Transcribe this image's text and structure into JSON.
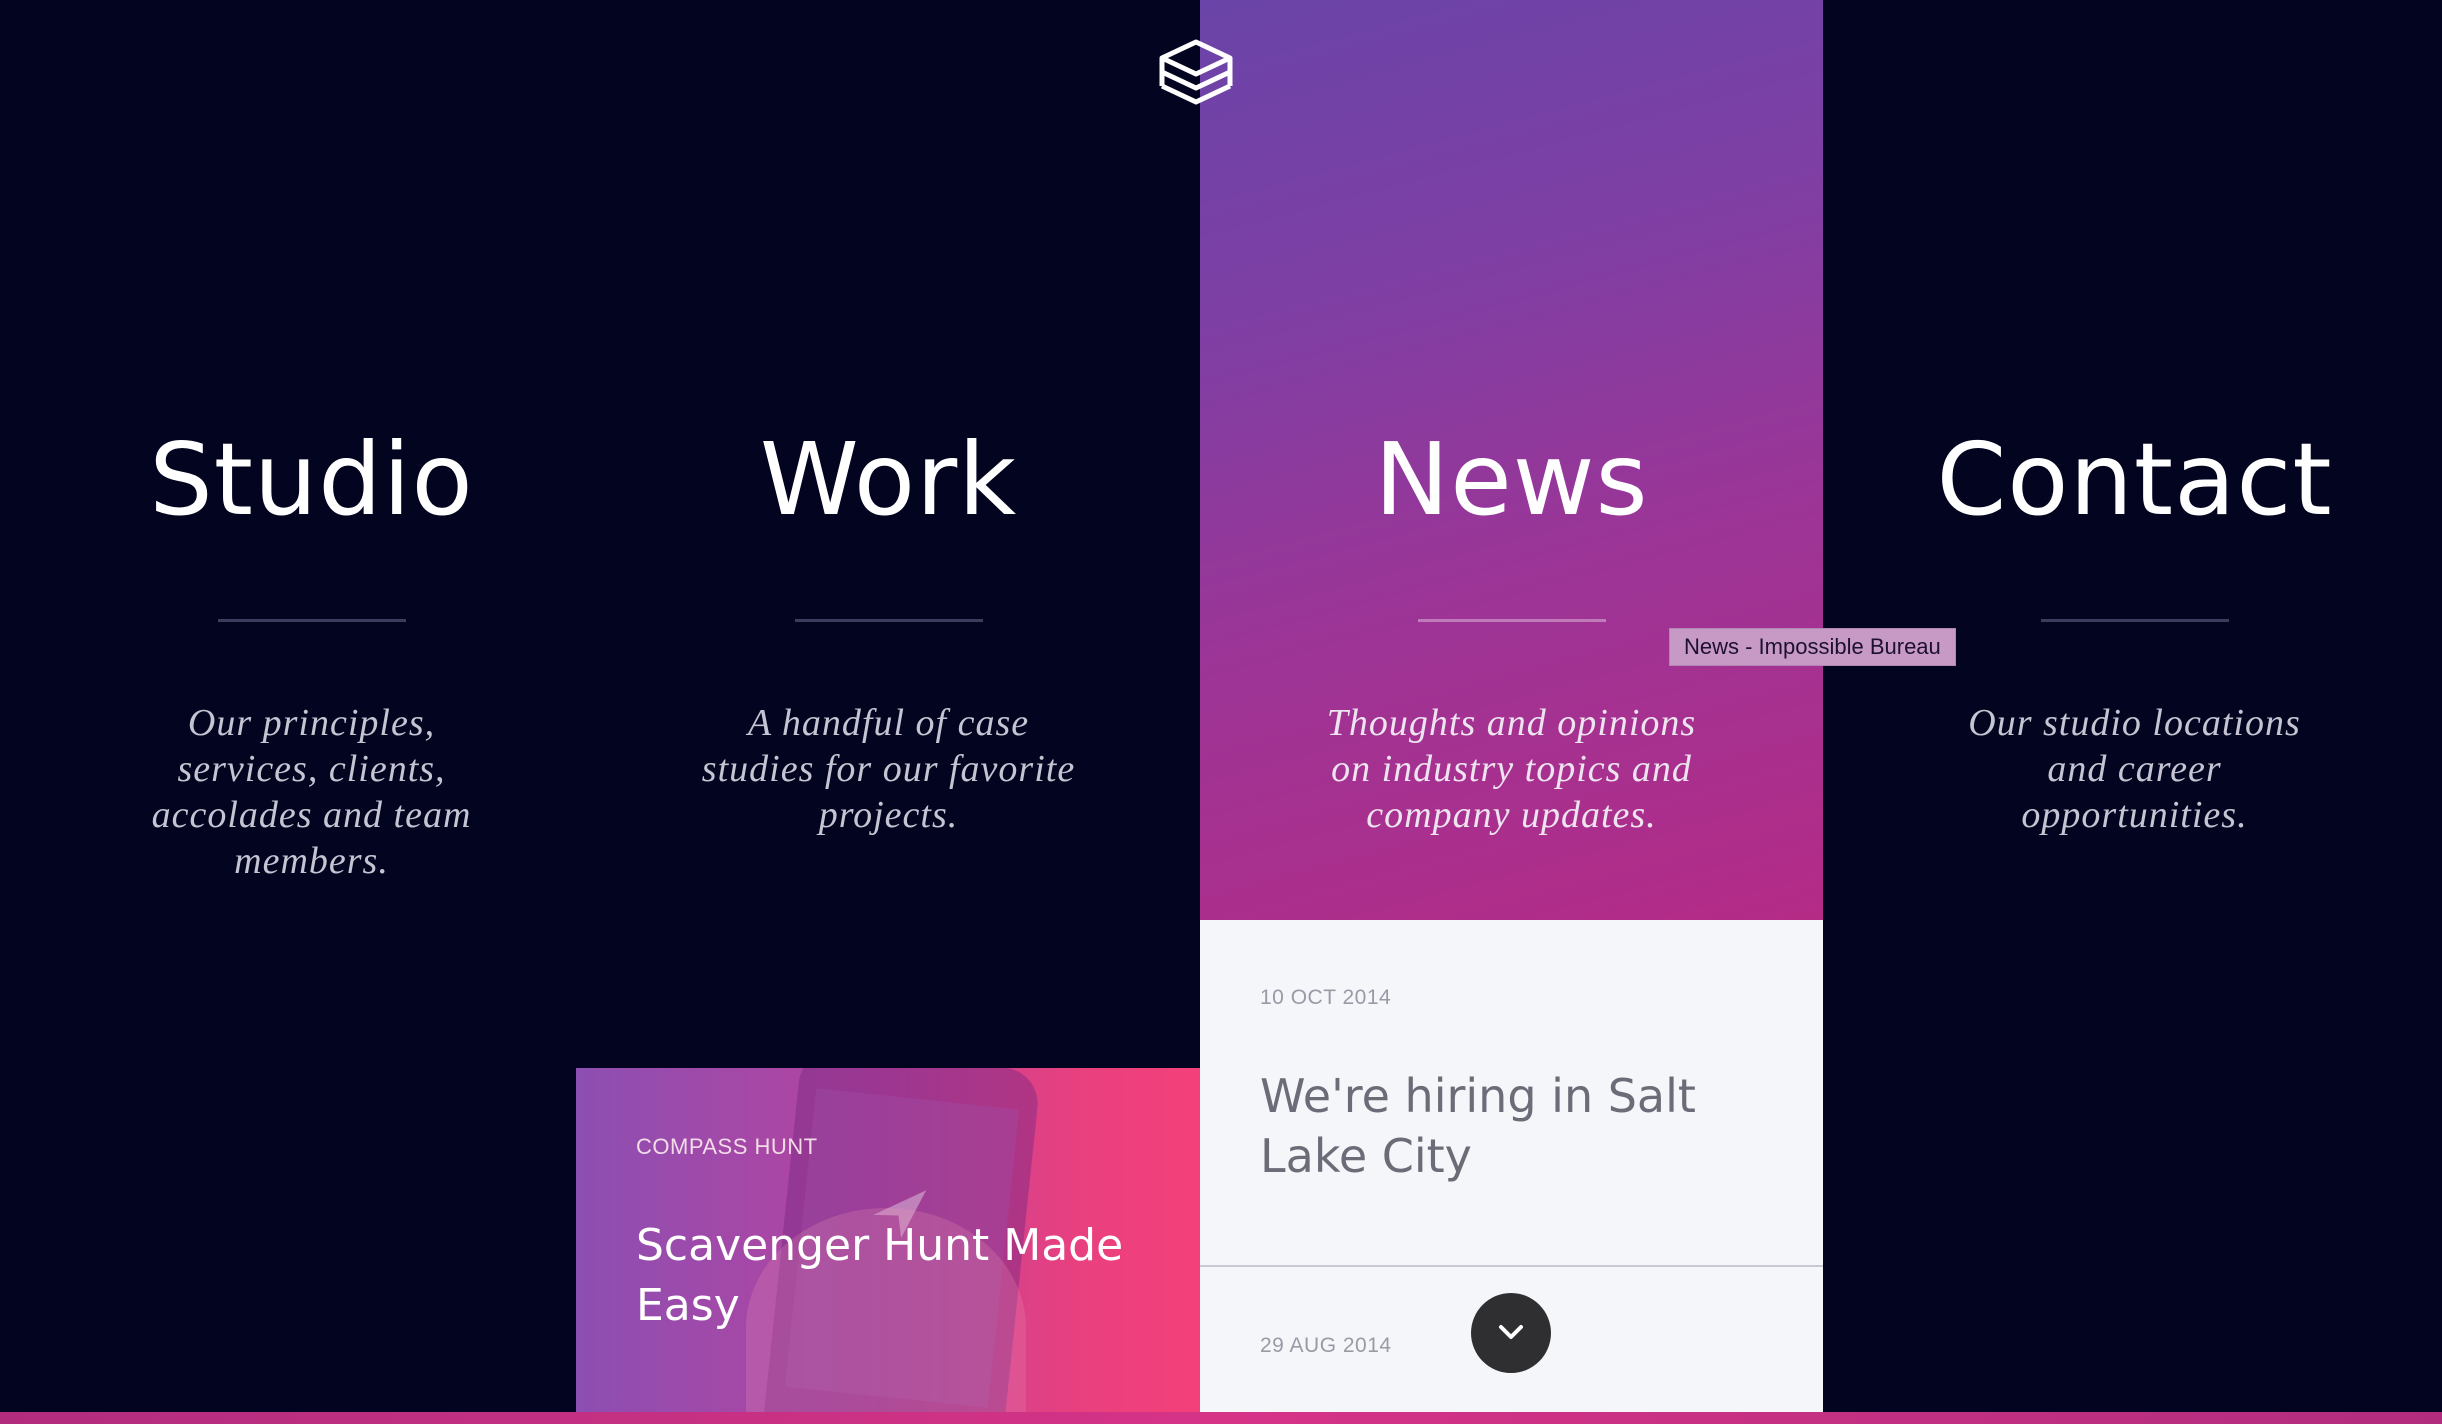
{
  "nav": {
    "logo_icon": "stacked-layers-icon",
    "columns": [
      {
        "title": "Studio",
        "description": "Our principles, services, clients, accolades and team members."
      },
      {
        "title": "Work",
        "description": "A handful of case studies for our favorite projects."
      },
      {
        "title": "News",
        "description": "Thoughts and opinions on industry topics and company updates."
      },
      {
        "title": "Contact",
        "description": "Our studio locations and career opportunities."
      }
    ]
  },
  "tooltip": {
    "text": "News - Impossible Bureau"
  },
  "work_card": {
    "eyebrow": "COMPASS HUNT",
    "title": "Scavenger Hunt Made Easy"
  },
  "news_list": {
    "items": [
      {
        "date": "10 OCT 2014",
        "title": "We're hiring in Salt Lake City"
      },
      {
        "date": "29 AUG 2014",
        "title": ""
      }
    ]
  },
  "scroll_button": {
    "icon": "chevron-down-icon"
  },
  "colors": {
    "background": "#020420",
    "news_gradient_top": "#6a44a8",
    "news_gradient_bottom": "#b42b86",
    "card_gradient_left": "#8c4fb2",
    "card_gradient_right": "#f4407a",
    "news_panel": "#f5f6fa"
  }
}
